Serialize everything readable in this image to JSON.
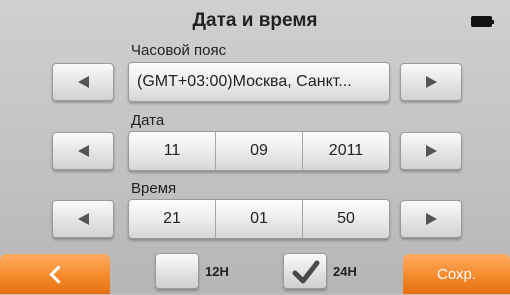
{
  "header": {
    "title": "Дата и время",
    "battery_icon": "battery-icon"
  },
  "timezone": {
    "label": "Часовой пояс",
    "value": "(GMT+03:00)Москва, Санкт..."
  },
  "date": {
    "label": "Дата",
    "day": "11",
    "month": "09",
    "year": "2011"
  },
  "time": {
    "label": "Время",
    "hour": "21",
    "minute": "01",
    "second": "50"
  },
  "footer": {
    "back_icon": "chevron-left-icon",
    "format_12_label": "12H",
    "format_24_label": "24H",
    "format_12_checked": false,
    "format_24_checked": true,
    "save_label": "Сохр."
  },
  "colors": {
    "accent": "#f58a2c",
    "background": "#c6c6c6"
  }
}
